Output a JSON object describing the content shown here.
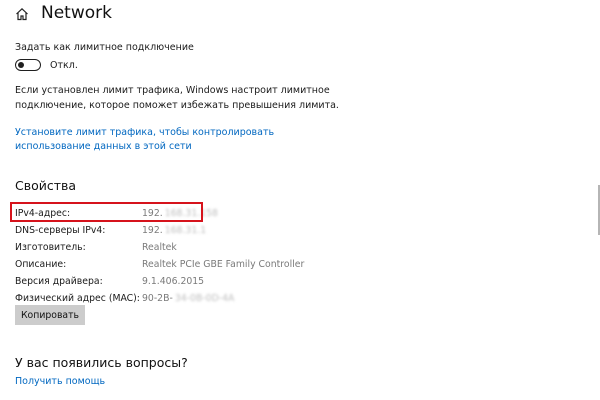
{
  "header": {
    "title": "Network",
    "icon": "home-icon"
  },
  "metered": {
    "label": "Задать как лимитное подключение",
    "toggle_state": "Откл.",
    "toggle_on": false,
    "description_line1": "Если установлен лимит трафика, Windows настроит лимитное",
    "description_line2": "подключение, которое поможет избежать превышения лимита.",
    "link_line1": "Установите лимит трафика, чтобы контролировать",
    "link_line2": "использование данных в этой сети"
  },
  "properties": {
    "title": "Свойства",
    "rows": [
      {
        "label": "IPv4-адрес:",
        "value": "192.",
        "masked": "168.31.158"
      },
      {
        "label": "DNS-серверы IPv4:",
        "value": "192.",
        "masked": "168.31.1"
      },
      {
        "label": "Изготовитель:",
        "value": "Realtek",
        "masked": ""
      },
      {
        "label": "Описание:",
        "value": "Realtek PCIe GBE Family Controller",
        "masked": ""
      },
      {
        "label": "Версия драйвера:",
        "value": "9.1.406.2015",
        "masked": ""
      },
      {
        "label": "Физический адрес (MAC):",
        "value": "90-2B-",
        "masked": "34-0B-0D-4A"
      }
    ],
    "copy_button": "Копировать",
    "highlight_color": "#d6131c"
  },
  "help": {
    "title": "У вас появились вопросы?",
    "link": "Получить помощь"
  },
  "colors": {
    "link": "#0067c0",
    "value_text": "#7a7a7a",
    "button_bg": "#cccccc"
  }
}
